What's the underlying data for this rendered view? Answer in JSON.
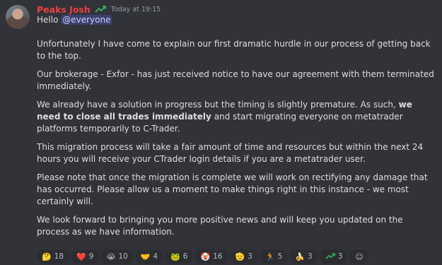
{
  "author": {
    "name": "Peaks Josh",
    "color": "#f23f43",
    "role_icon": "green-arrow-icon"
  },
  "timestamp": "Today at 19:15",
  "greeting": "Hello",
  "mention": "@everyone",
  "paragraphs": {
    "p1": "Unfortunately I have come to explain our first dramatic hurdle in our process of getting back to the top.",
    "p2": "Our brokerage - Exfor - has just received notice to have our agreement with them terminated immediately.",
    "p3a": "We already have a solution in progress but the timing is slightly premature. As such,",
    "p3b": "we need to close all trades immediately",
    "p3c": "and start migrating everyone on metatrader platforms temporarily to C-Trader.",
    "p4": "This migration process will take a fair amount of time and resources but within the next 24 hours you will receive your CTrader login details if you are a metatrader user.",
    "p5": "Please note that once the migration is complete we will work on rectifying any damage that has occurred. Please allow us a moment to make things right in this instance - we most certainly will.",
    "p6": "We look forward to bringing you more positive news and will keep you updated on the process as we have information."
  },
  "reactions": [
    {
      "emoji": "🤔",
      "icon": "thinking-face-icon",
      "count": "18"
    },
    {
      "emoji": "❤️",
      "icon": "red-heart-icon",
      "count": "9"
    },
    {
      "emoji": "😭",
      "icon": "crying-face-icon",
      "count": "10"
    },
    {
      "emoji": "🤝",
      "icon": "handshake-icon",
      "count": "4"
    },
    {
      "emoji": "🐸",
      "icon": "frog-icon",
      "count": "6"
    },
    {
      "emoji": "🤡",
      "icon": "clown-face-icon",
      "count": "16"
    },
    {
      "emoji": "🫡",
      "icon": "saluting-face-icon",
      "count": "3"
    },
    {
      "emoji": "🏃",
      "icon": "running-person-icon",
      "count": "5"
    },
    {
      "emoji": "🍌",
      "icon": "banana-icon",
      "count": "3"
    },
    {
      "emoji": "⏫",
      "icon": "green-arrow-icon",
      "count": "3"
    }
  ],
  "add_reaction": {
    "icon": "add-reaction-smiley-icon",
    "emoji": "☺"
  }
}
